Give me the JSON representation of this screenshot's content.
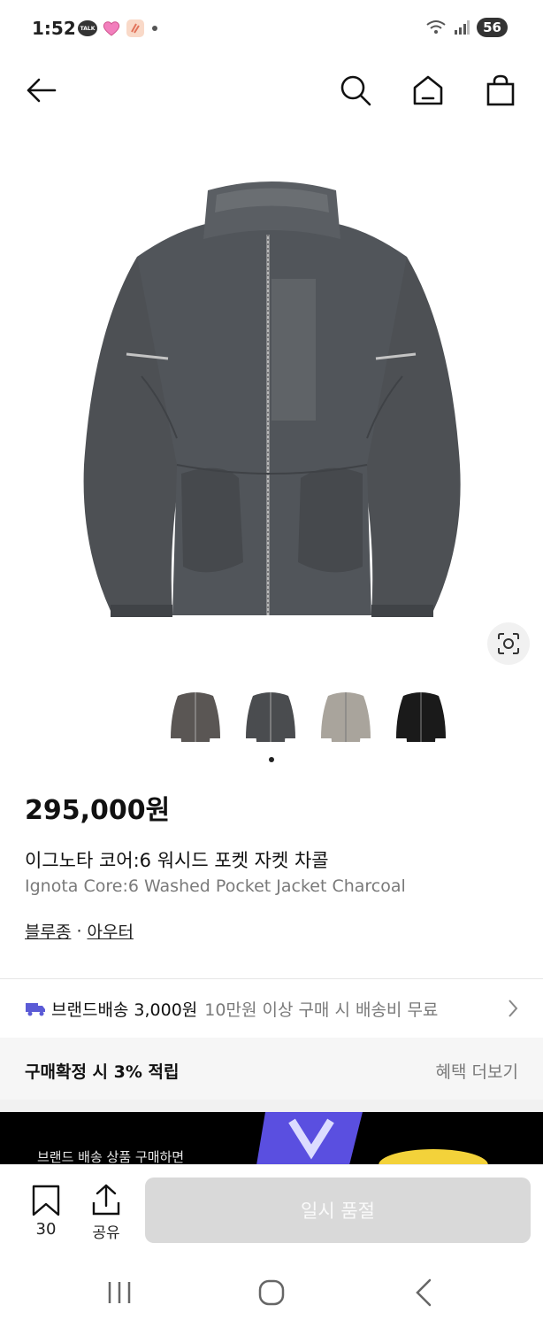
{
  "status_bar": {
    "time": "1:52",
    "talk_badge": "TALK",
    "battery_level": "56",
    "icons": [
      "talk-icon",
      "heart-icon",
      "app-icon",
      "dot-icon",
      "wifi-icon",
      "signal-icon",
      "battery-icon"
    ]
  },
  "nav": {
    "icons": [
      "back-arrow-icon",
      "search-icon",
      "home-icon",
      "shopping-bag-icon"
    ]
  },
  "product": {
    "price": "295,000원",
    "name_ko": "이그노타 코어:6 워시드 포켓 자켓 차콜",
    "name_en": "Ignota Core:6 Washed Pocket Jacket Charcoal",
    "category_1": "블루종",
    "category_sep": "·",
    "category_2": "아우터",
    "thumbnails": [
      {
        "color": "#5a5654"
      },
      {
        "color": "#4a4c4f"
      },
      {
        "color": "#a9a49c"
      },
      {
        "color": "#1a1a1a"
      }
    ],
    "active_thumbnail": 2
  },
  "shipping": {
    "label": "브랜드배송",
    "fee": "3,000원",
    "condition": "10만원 이상 구매 시 배송비 무료"
  },
  "benefit": {
    "title": "구매확정 시 3% 적립",
    "more": "혜택 더보기"
  },
  "banner": {
    "text": "브랜드 배송 상품 구매하면"
  },
  "action_bar": {
    "bookmark_count": "30",
    "share_label": "공유",
    "button_label": "일시 품절"
  },
  "colors": {
    "jacket": "#4b4e52",
    "button_disabled": "#d9d9d9",
    "truck": "#5b5bd6",
    "banner_bg": "#000000"
  }
}
